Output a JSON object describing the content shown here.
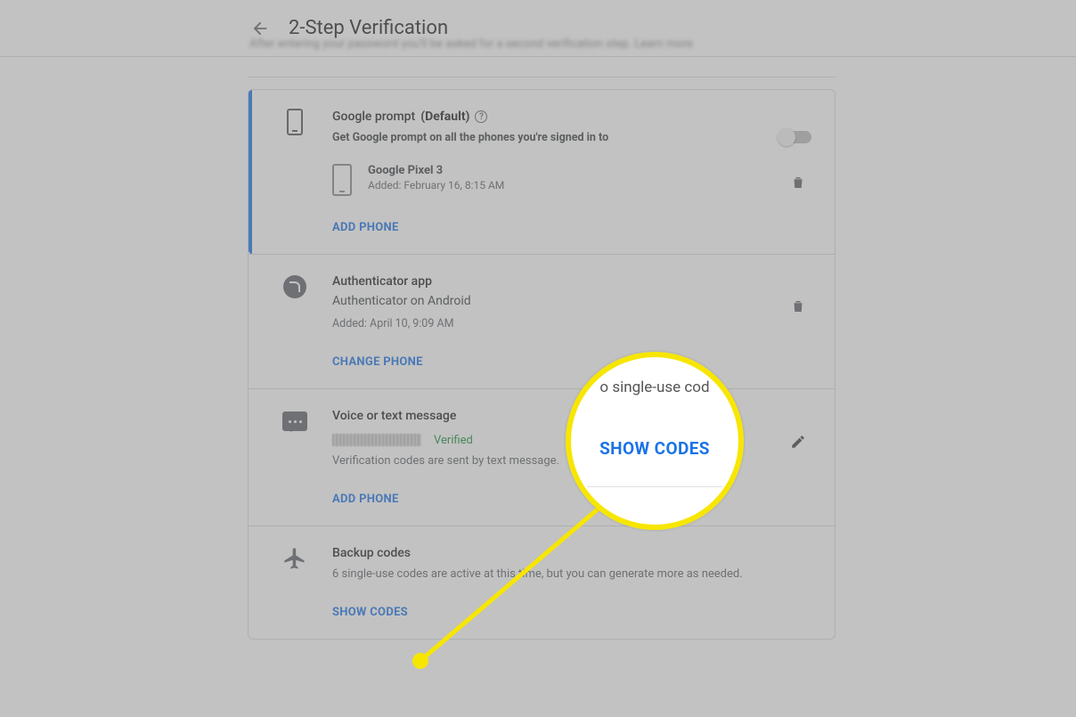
{
  "header": {
    "title": "2-Step Verification",
    "blurred_subtext": "After entering your password you'll be asked for a second verification step. Learn more"
  },
  "sections": {
    "prompt": {
      "title_prefix": "Google prompt ",
      "title_default": "(Default)",
      "sub": "Get Google prompt on all the phones you're signed in to",
      "device_name": "Google Pixel 3",
      "device_added": "Added: February 16, 8:15 AM",
      "action": "ADD PHONE"
    },
    "auth": {
      "title": "Authenticator app",
      "sub": "Authenticator on Android",
      "added": "Added: April 10, 9:09 AM",
      "action": "CHANGE PHONE"
    },
    "sms": {
      "title": "Voice or text message",
      "verified": "Verified",
      "desc": "Verification codes are sent by text message.",
      "action": "ADD PHONE"
    },
    "backup": {
      "title": "Backup codes",
      "desc": "6 single-use codes are active at this time, but you can generate more as needed.",
      "action": "SHOW CODES"
    }
  },
  "callout": {
    "peek_text": "o single-use cod",
    "button": "SHOW CODES"
  }
}
